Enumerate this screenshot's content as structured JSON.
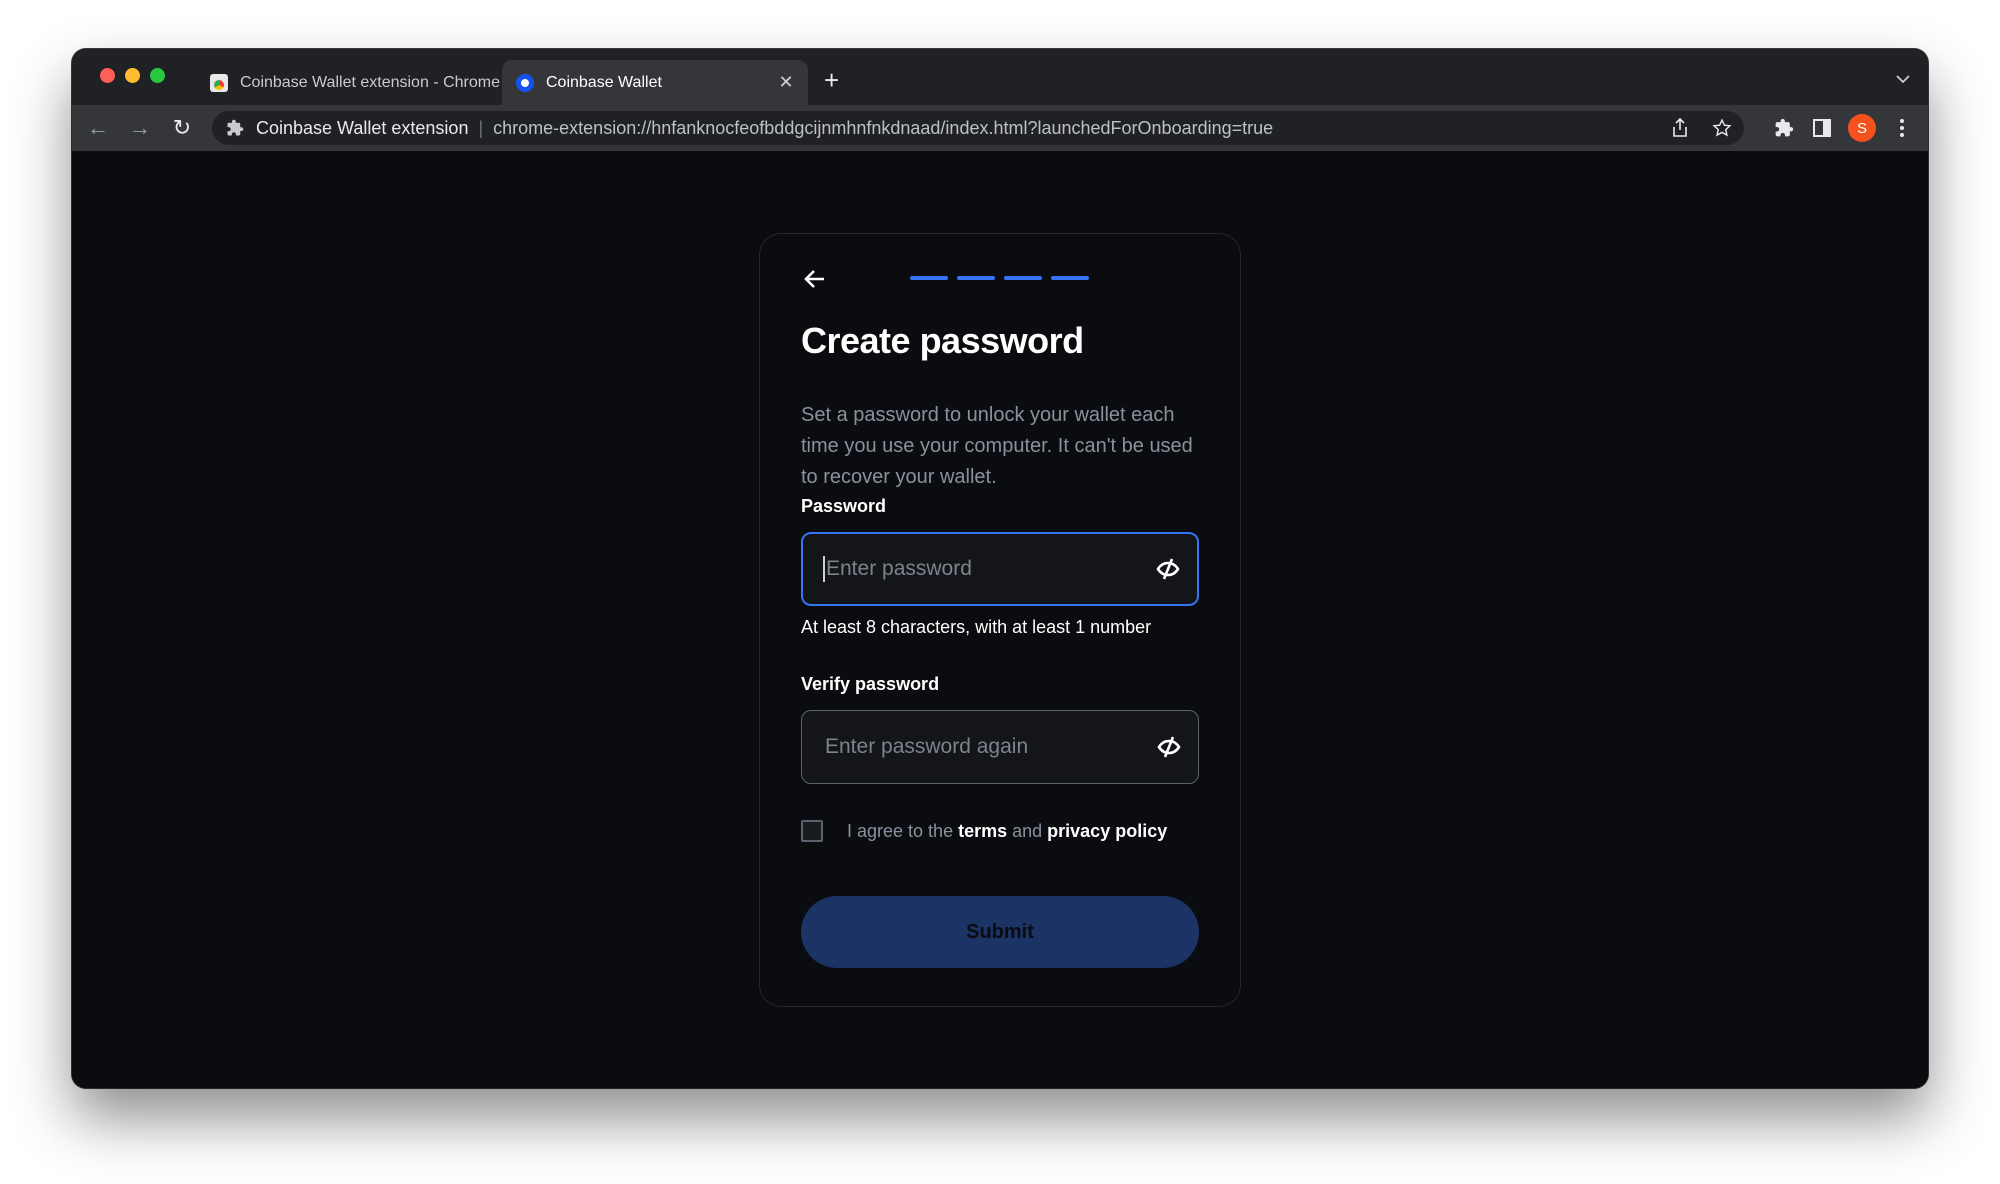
{
  "browser": {
    "tabs": [
      {
        "title": "Coinbase Wallet extension - Chrome Web Store",
        "favicon": "chrome-web-store-icon",
        "active": false
      },
      {
        "title": "Coinbase Wallet",
        "favicon": "coinbase-wallet-icon",
        "active": true
      }
    ],
    "close_glyph": "✕",
    "new_tab_glyph": "+",
    "tab_search_glyph": "⌄",
    "nav": {
      "back": "←",
      "forward": "→",
      "reload": "↻"
    },
    "address_bar": {
      "site_label": "Coinbase Wallet extension",
      "separator": "|",
      "url": "chrome-extension://hnfanknocfeofbddgcijnmhnfnkdnaad/index.html?launchedForOnboarding=true"
    },
    "profile_initial": "S",
    "colors": {
      "profile": "#f4511e"
    }
  },
  "onboarding": {
    "progress": {
      "total_steps": 4,
      "completed_steps": 4
    },
    "title": "Create password",
    "description": "Set a password to unlock your wallet each time you use your computer. It can't be used to recover your wallet.",
    "password": {
      "label": "Password",
      "value": "",
      "placeholder": "Enter password",
      "hint": "At least 8 characters, with at least 1 number",
      "focused": true
    },
    "verify_password": {
      "label": "Verify password",
      "value": "",
      "placeholder": "Enter password again"
    },
    "agreement": {
      "checked": false,
      "prefix": "I agree to the ",
      "terms_link": "terms",
      "middle": " and ",
      "privacy_link": "privacy policy"
    },
    "submit_label": "Submit",
    "colors": {
      "accent": "#3773f5",
      "submit_disabled_bg": "#1c3366",
      "background": "#0b0c0f"
    }
  }
}
